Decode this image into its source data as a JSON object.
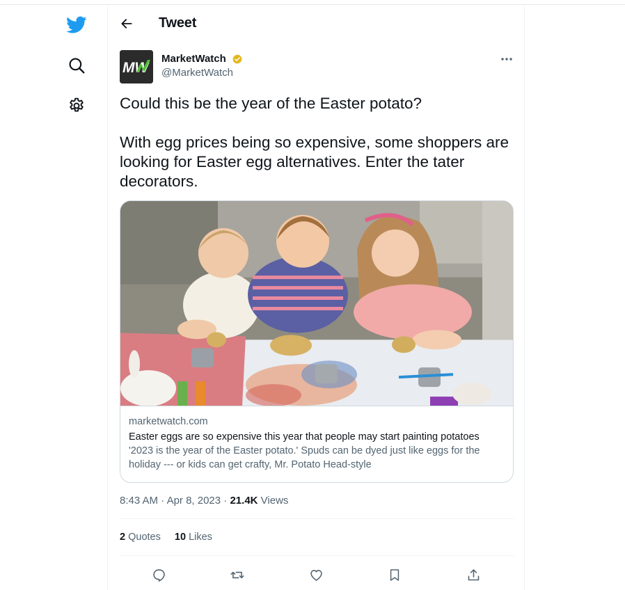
{
  "nav": {
    "items": [
      {
        "icon": "twitter-bird-icon"
      },
      {
        "icon": "search-icon"
      },
      {
        "icon": "settings-icon"
      }
    ],
    "brand_color": "#1d9bf0"
  },
  "header": {
    "title": "Tweet",
    "back_icon": "back-arrow-icon"
  },
  "tweet": {
    "author": {
      "name": "MarketWatch",
      "handle": "@MarketWatch",
      "avatar_text": "MW",
      "verified_badge_color": "#e2b719"
    },
    "text_lines": [
      "Could this be the year of the Easter potato?",
      "With egg prices being so expensive, some shoppers are looking for Easter egg alternatives. Enter the tater decorators."
    ],
    "card": {
      "domain": "marketwatch.com",
      "title": "Easter eggs are so expensive this year that people may start painting potatoes",
      "description": "'2023 is the year of the Easter potato.' Spuds can be dyed just like eggs for the holiday --- or kids can get crafty, Mr. Potato Head-style"
    },
    "time": "8:43 AM",
    "date": "Apr 8, 2023",
    "separator": "·",
    "views_count": "21.4K",
    "views_label": "Views",
    "quotes_count": "2",
    "quotes_label": "Quotes",
    "likes_count": "10",
    "likes_label": "Likes"
  },
  "actions": [
    {
      "icon": "reply-icon"
    },
    {
      "icon": "retweet-icon"
    },
    {
      "icon": "like-icon"
    },
    {
      "icon": "bookmark-icon"
    },
    {
      "icon": "share-icon"
    }
  ]
}
